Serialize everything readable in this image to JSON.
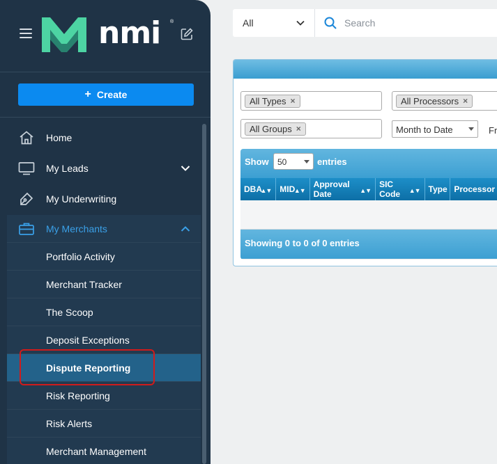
{
  "brand": {
    "name": "nmi",
    "reg_mark": "®",
    "accent": "#4dd4a3",
    "sidebar_bg": "#1f3346",
    "primary_button": "#0b8af0",
    "active_item": "#23628a",
    "highlight_outline": "#d01b1b"
  },
  "sidebar": {
    "create_label": "Create",
    "items": [
      {
        "label": "Home",
        "icon": "home-icon"
      },
      {
        "label": "My Leads",
        "icon": "monitor-icon",
        "expand": "chevron-down-icon"
      },
      {
        "label": "My Underwriting",
        "icon": "pen-tool-icon"
      }
    ],
    "merchants": {
      "label": "My Merchants",
      "icon": "briefcase-icon",
      "expand": "chevron-up-icon",
      "sub_items": [
        {
          "label": "Portfolio Activity"
        },
        {
          "label": "Merchant Tracker"
        },
        {
          "label": "The Scoop"
        },
        {
          "label": "Deposit Exceptions"
        },
        {
          "label": "Dispute Reporting",
          "active": true
        },
        {
          "label": "Risk Reporting"
        },
        {
          "label": "Risk Alerts"
        },
        {
          "label": "Merchant Management"
        }
      ]
    }
  },
  "topbar": {
    "scope_value": "All",
    "search_placeholder": "Search"
  },
  "filters": {
    "types_chip": "All Types",
    "processors_chip": "All Processors",
    "groups_chip": "All Groups",
    "period_value": "Month to Date",
    "from_label": "Fr",
    "remove_symbol": "×"
  },
  "table": {
    "show_label": "Show",
    "page_length": "50",
    "entries_label": "entries",
    "columns": [
      "DBA",
      "MID",
      "Approval Date",
      "SIC Code",
      "Type",
      "Processor"
    ],
    "sort_symbol": "▲▼",
    "info": "Showing 0 to 0 of 0 entries"
  }
}
